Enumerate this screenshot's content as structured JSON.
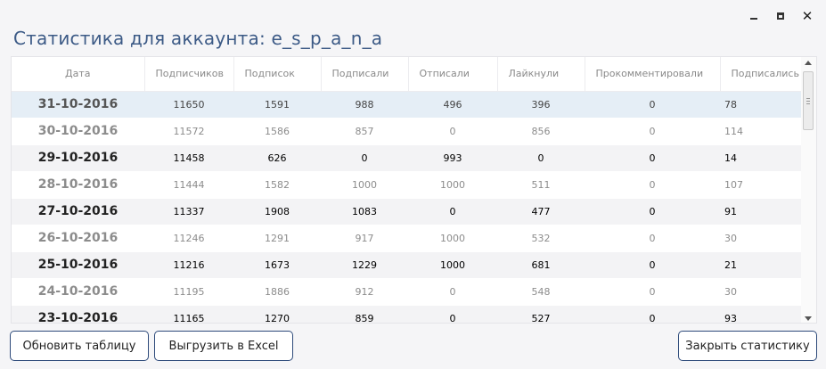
{
  "window": {
    "minimize_icon": "minimize-icon",
    "maximize_icon": "maximize-icon",
    "close_icon": "close-icon",
    "close_glyph": "✕"
  },
  "title": "Статистика для аккаунта: e_s_p_a_n_a",
  "table": {
    "columns": [
      "Дата",
      "Подписчиков",
      "Подписок",
      "Подписали",
      "Отписали",
      "Лайкнули",
      "Прокомментировали",
      "Подписались"
    ],
    "rows": [
      [
        "31-10-2016",
        "11650",
        "1591",
        "988",
        "496",
        "396",
        "0",
        "78"
      ],
      [
        "30-10-2016",
        "11572",
        "1586",
        "857",
        "0",
        "856",
        "0",
        "114"
      ],
      [
        "29-10-2016",
        "11458",
        "626",
        "0",
        "993",
        "0",
        "0",
        "14"
      ],
      [
        "28-10-2016",
        "11444",
        "1582",
        "1000",
        "1000",
        "511",
        "0",
        "107"
      ],
      [
        "27-10-2016",
        "11337",
        "1908",
        "1083",
        "0",
        "477",
        "0",
        "91"
      ],
      [
        "26-10-2016",
        "11246",
        "1291",
        "917",
        "1000",
        "532",
        "0",
        "30"
      ],
      [
        "25-10-2016",
        "11216",
        "1673",
        "1229",
        "1000",
        "681",
        "0",
        "21"
      ],
      [
        "24-10-2016",
        "11195",
        "1886",
        "912",
        "0",
        "548",
        "0",
        "30"
      ],
      [
        "23-10-2016",
        "11165",
        "1270",
        "859",
        "0",
        "527",
        "0",
        "93"
      ]
    ],
    "selected_row": 0
  },
  "buttons": {
    "refresh": "Обновить таблицу",
    "export": "Выгрузить в Excel",
    "close": "Закрыть статистику"
  },
  "colors": {
    "title": "#3c5a86",
    "button_border": "#2d4a7a",
    "selected_row": "#e5eef6",
    "alt_row": "#f3f3f5"
  }
}
